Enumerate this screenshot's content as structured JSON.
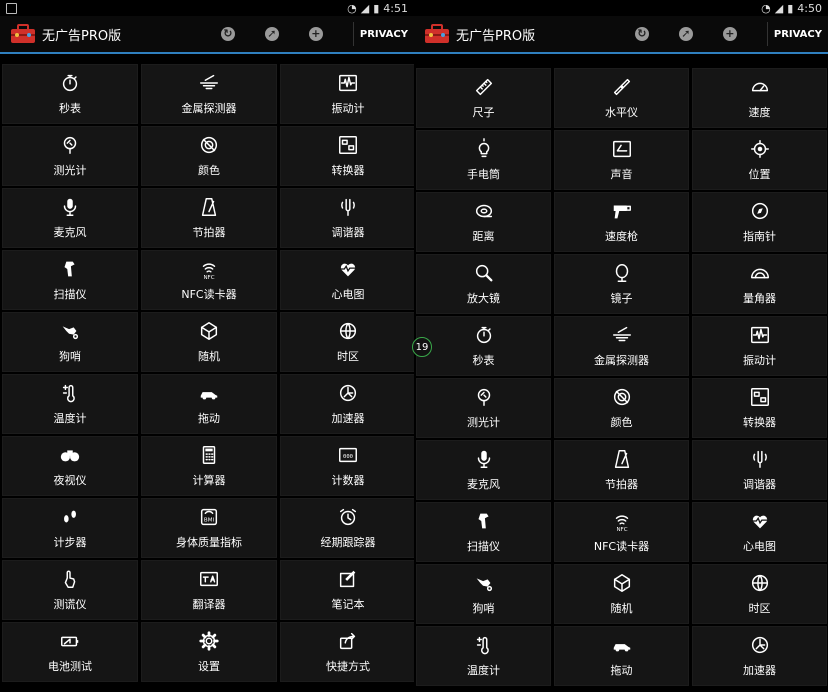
{
  "left": {
    "time": "4:51",
    "app_title": "无广告PRO版",
    "privacy_label": "PRIVACY",
    "tools": [
      {
        "label": "秒表",
        "icon": "stopwatch-icon"
      },
      {
        "label": "金属探测器",
        "icon": "metal-detector-icon"
      },
      {
        "label": "振动计",
        "icon": "vibration-meter-icon"
      },
      {
        "label": "测光计",
        "icon": "light-meter-icon"
      },
      {
        "label": "颜色",
        "icon": "color-icon"
      },
      {
        "label": "转换器",
        "icon": "converter-icon"
      },
      {
        "label": "麦克风",
        "icon": "microphone-icon"
      },
      {
        "label": "节拍器",
        "icon": "metronome-icon"
      },
      {
        "label": "调谐器",
        "icon": "tuner-icon"
      },
      {
        "label": "扫描仪",
        "icon": "scanner-icon"
      },
      {
        "label": "NFC读卡器",
        "icon": "nfc-icon"
      },
      {
        "label": "心电图",
        "icon": "heart-rate-icon"
      },
      {
        "label": "狗哨",
        "icon": "dog-whistle-icon"
      },
      {
        "label": "随机",
        "icon": "dice-icon"
      },
      {
        "label": "时区",
        "icon": "globe-icon"
      },
      {
        "label": "温度计",
        "icon": "thermometer-icon"
      },
      {
        "label": "拖动",
        "icon": "car-icon"
      },
      {
        "label": "加速器",
        "icon": "accelerometer-icon"
      },
      {
        "label": "夜视仪",
        "icon": "binoculars-icon"
      },
      {
        "label": "计算器",
        "icon": "calculator-icon"
      },
      {
        "label": "计数器",
        "icon": "counter-icon"
      },
      {
        "label": "计步器",
        "icon": "footprints-icon"
      },
      {
        "label": "身体质量指标",
        "icon": "bmi-scale-icon"
      },
      {
        "label": "经期跟踪器",
        "icon": "alarm-clock-icon"
      },
      {
        "label": "测谎仪",
        "icon": "touch-hand-icon"
      },
      {
        "label": "翻译器",
        "icon": "translate-icon"
      },
      {
        "label": "笔记本",
        "icon": "edit-note-icon"
      },
      {
        "label": "电池测试",
        "icon": "battery-icon"
      },
      {
        "label": "设置",
        "icon": "gear-icon"
      },
      {
        "label": "快捷方式",
        "icon": "share-icon"
      }
    ]
  },
  "right": {
    "time": "4:50",
    "app_title": "无广告PRO版",
    "privacy_label": "PRIVACY",
    "tools": [
      {
        "label": "尺子",
        "icon": "ruler-icon"
      },
      {
        "label": "水平仪",
        "icon": "level-icon"
      },
      {
        "label": "速度",
        "icon": "speedometer-icon"
      },
      {
        "label": "手电筒",
        "icon": "flashlight-bulb-icon"
      },
      {
        "label": "声音",
        "icon": "sound-meter-icon"
      },
      {
        "label": "位置",
        "icon": "location-icon"
      },
      {
        "label": "距离",
        "icon": "tape-measure-icon"
      },
      {
        "label": "速度枪",
        "icon": "speed-gun-icon"
      },
      {
        "label": "指南针",
        "icon": "compass-icon"
      },
      {
        "label": "放大镜",
        "icon": "magnifier-icon"
      },
      {
        "label": "镜子",
        "icon": "mirror-icon"
      },
      {
        "label": "量角器",
        "icon": "protractor-icon"
      },
      {
        "label": "秒表",
        "icon": "stopwatch-icon"
      },
      {
        "label": "金属探测器",
        "icon": "metal-detector-icon"
      },
      {
        "label": "振动计",
        "icon": "vibration-meter-icon"
      },
      {
        "label": "测光计",
        "icon": "light-meter-icon"
      },
      {
        "label": "颜色",
        "icon": "color-icon"
      },
      {
        "label": "转换器",
        "icon": "converter-icon"
      },
      {
        "label": "麦克风",
        "icon": "microphone-icon"
      },
      {
        "label": "节拍器",
        "icon": "metronome-icon"
      },
      {
        "label": "调谐器",
        "icon": "tuner-icon"
      },
      {
        "label": "扫描仪",
        "icon": "scanner-icon"
      },
      {
        "label": "NFC读卡器",
        "icon": "nfc-icon"
      },
      {
        "label": "心电图",
        "icon": "heart-rate-icon"
      },
      {
        "label": "狗哨",
        "icon": "dog-whistle-icon"
      },
      {
        "label": "随机",
        "icon": "dice-icon"
      },
      {
        "label": "时区",
        "icon": "globe-icon"
      },
      {
        "label": "温度计",
        "icon": "thermometer-icon"
      },
      {
        "label": "拖动",
        "icon": "car-icon"
      },
      {
        "label": "加速器",
        "icon": "accelerometer-icon"
      }
    ]
  },
  "overlay_badge": "19",
  "colors": {
    "accent": "#2f7fbf",
    "tile": "#151515",
    "background": "#000000",
    "app_icon": "#d0302a"
  }
}
